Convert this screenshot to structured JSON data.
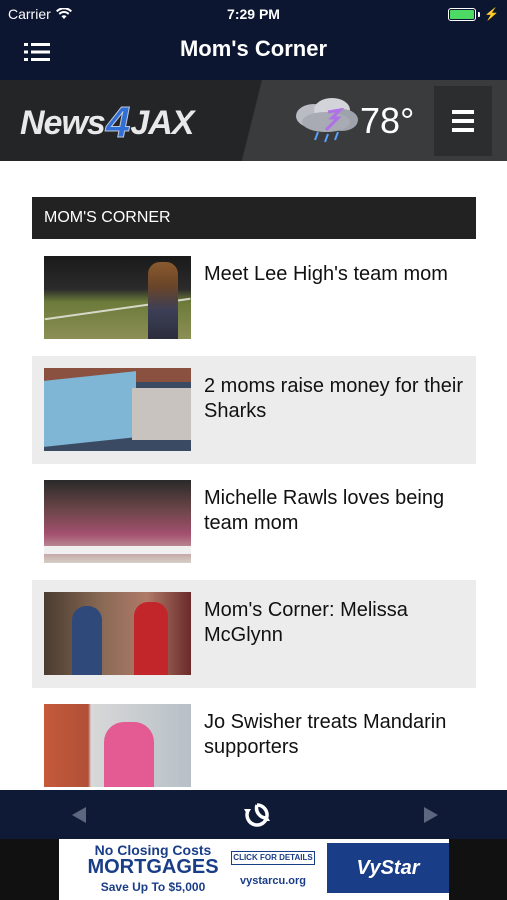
{
  "status_bar": {
    "carrier": "Carrier",
    "time": "7:29 PM"
  },
  "nav": {
    "title": "Mom's Corner"
  },
  "brand": {
    "logo_left": "News",
    "logo_four": "4",
    "logo_right": "JAX",
    "temperature": "78°",
    "weather_icon": "thunderstorm-cloud-icon"
  },
  "section": {
    "title": "MOM'S CORNER"
  },
  "articles": [
    {
      "title": "Meet Lee High's team mom"
    },
    {
      "title": "2 moms raise money for their Sharks"
    },
    {
      "title": "Michelle Rawls loves being team mom"
    },
    {
      "title": "Mom's Corner: Melissa McGlynn"
    },
    {
      "title": "Jo Swisher treats Mandarin supporters"
    }
  ],
  "toolbar": {
    "back_icon": "back-arrow-icon",
    "refresh_icon": "refresh-icon",
    "forward_icon": "forward-arrow-icon"
  },
  "ad": {
    "line1": "No Closing Costs",
    "line2": "MORTGAGES",
    "line3": "Save Up To $5,000",
    "cta": "CLICK FOR DETAILS",
    "url": "vystarcu.org",
    "brand": "VyStar"
  },
  "colors": {
    "nav_bg": "#0d1630",
    "brand_blue": "#2f6fd6",
    "ad_blue": "#1a3d88"
  }
}
